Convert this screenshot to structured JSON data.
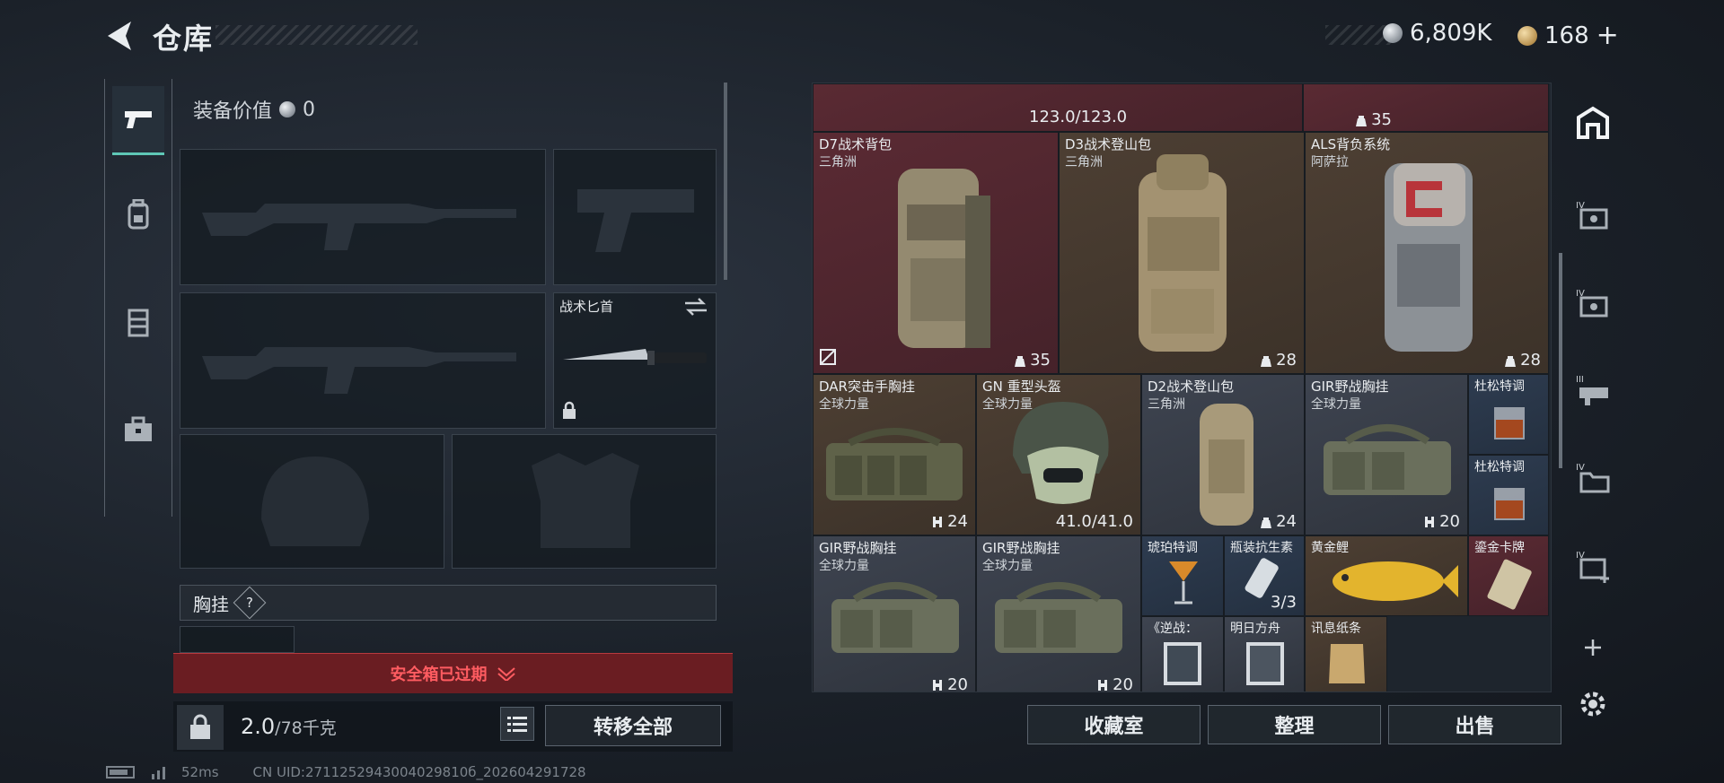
{
  "header": {
    "title": "仓库",
    "silver": "6,809K",
    "gold": "168",
    "plus": "+"
  },
  "loadout": {
    "equip_value_label": "装备价值",
    "equip_value": "0",
    "knife_label": "战术匕首",
    "chest_label": "胸挂",
    "chest_help": "?",
    "safe_status": "安全箱已过期",
    "weight_value": "2.0",
    "weight_total": "/78千克",
    "transfer_all": "转移全部"
  },
  "grid": {
    "top_row": {
      "durability": "123.0/123.0",
      "capacity": "35"
    },
    "items": [
      {
        "name": "D7战术背包",
        "sub": "三角洲",
        "count": "35"
      },
      {
        "name": "D3战术登山包",
        "sub": "三角洲",
        "count": "28"
      },
      {
        "name": "ALS背负系统",
        "sub": "阿萨拉",
        "count": "28"
      },
      {
        "name": "DAR突击手胸挂",
        "sub": "全球力量",
        "count": "24"
      },
      {
        "name": "GN 重型头盔",
        "sub": "全球力量",
        "count": "41.0/41.0"
      },
      {
        "name": "D2战术登山包",
        "sub": "三角洲",
        "count": "24"
      },
      {
        "name": "GIR野战胸挂",
        "sub": "全球力量",
        "count": "20"
      },
      {
        "name": "杜松特调",
        "sub": "",
        "count": ""
      },
      {
        "name": "杜松特调",
        "sub": "",
        "count": ""
      },
      {
        "name": "GIR野战胸挂",
        "sub": "全球力量",
        "count": "20"
      },
      {
        "name": "GIR野战胸挂",
        "sub": "全球力量",
        "count": "20"
      },
      {
        "name": "琥珀特调",
        "sub": "",
        "count": ""
      },
      {
        "name": "瓶装抗生素",
        "sub": "",
        "count": "3/3"
      },
      {
        "name": "黄金鲤",
        "sub": "",
        "count": ""
      },
      {
        "name": "鎏金卡牌",
        "sub": "",
        "count": ""
      },
      {
        "name": "《逆战：",
        "sub": "",
        "count": ""
      },
      {
        "name": "明日方舟",
        "sub": "",
        "count": ""
      },
      {
        "name": "讯息纸条",
        "sub": "",
        "count": ""
      }
    ]
  },
  "actions": {
    "collection": "收藏室",
    "organize": "整理",
    "sell": "出售"
  },
  "status": {
    "ping": "52ms",
    "uid": "CN UID:2711252943004029810б_202604291728"
  },
  "colors": {
    "accent": "#5fc7b6",
    "danger": "#ff5c61",
    "rare_red": "#5a2a33"
  }
}
